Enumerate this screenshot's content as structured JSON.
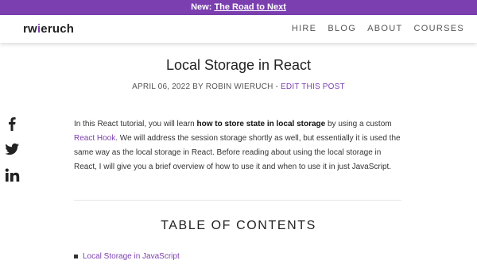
{
  "banner": {
    "prefix": "New:",
    "link": "The Road to Next"
  },
  "logo": {
    "part1": "rw",
    "dot": "i",
    "part2": "eruch"
  },
  "nav": [
    "HIRE",
    "BLOG",
    "ABOUT",
    "COURSES"
  ],
  "article": {
    "title": "Local Storage in React",
    "meta_prefix": "APRIL 06, 2022 BY ROBIN WIERUCH -",
    "meta_link": "EDIT THIS POST",
    "intro": {
      "t1": "In this React tutorial, you will learn ",
      "bold": "how to store state in local storage",
      "t2": " by using a custom ",
      "link": "React Hook",
      "t3": ". We will address the session storage shortly as well, but essentially it is used the same way as the local storage in React. Before reading about using the local storage in React, I will give you a brief overview of how to use it and when to use it in just JavaScript."
    },
    "toc_title": "TABLE OF CONTENTS",
    "toc_items": [
      "Local Storage in JavaScript"
    ]
  },
  "share_icons": [
    "facebook-icon",
    "twitter-icon",
    "linkedin-icon"
  ],
  "colors": {
    "accent": "#7b3fb0",
    "text": "#333333"
  }
}
